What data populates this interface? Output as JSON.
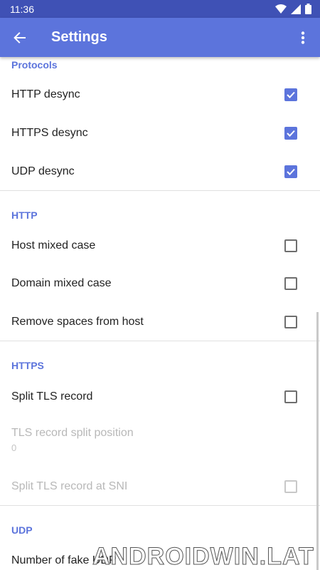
{
  "status_bar": {
    "time": "11:36",
    "icons": [
      "wifi-icon",
      "signal-icon",
      "battery-icon"
    ]
  },
  "app_bar": {
    "title": "Settings",
    "back_icon": "arrow-back-icon",
    "menu_icon": "more-vert-icon"
  },
  "sections": [
    {
      "title": "Protocols",
      "items": [
        {
          "label": "HTTP desync",
          "checked": true
        },
        {
          "label": "HTTPS desync",
          "checked": true
        },
        {
          "label": "UDP desync",
          "checked": true
        }
      ]
    },
    {
      "title": "HTTP",
      "items": [
        {
          "label": "Host mixed case",
          "checked": false
        },
        {
          "label": "Domain mixed case",
          "checked": false
        },
        {
          "label": "Remove spaces from host",
          "checked": false
        }
      ]
    },
    {
      "title": "HTTPS",
      "items": [
        {
          "label": "Split TLS record",
          "checked": false
        },
        {
          "label": "TLS record split position",
          "summary": "0",
          "disabled": true
        },
        {
          "label": "Split TLS record at SNI",
          "checked": false,
          "disabled": true
        }
      ]
    },
    {
      "title": "UDP",
      "items": [
        {
          "label": "Number of fake UDP"
        }
      ]
    }
  ],
  "watermark": "ANDROIDWIN.LAT",
  "colors": {
    "status_bar": "#3f51b5",
    "app_bar": "#5c74dc",
    "accent": "#5c74dc"
  }
}
